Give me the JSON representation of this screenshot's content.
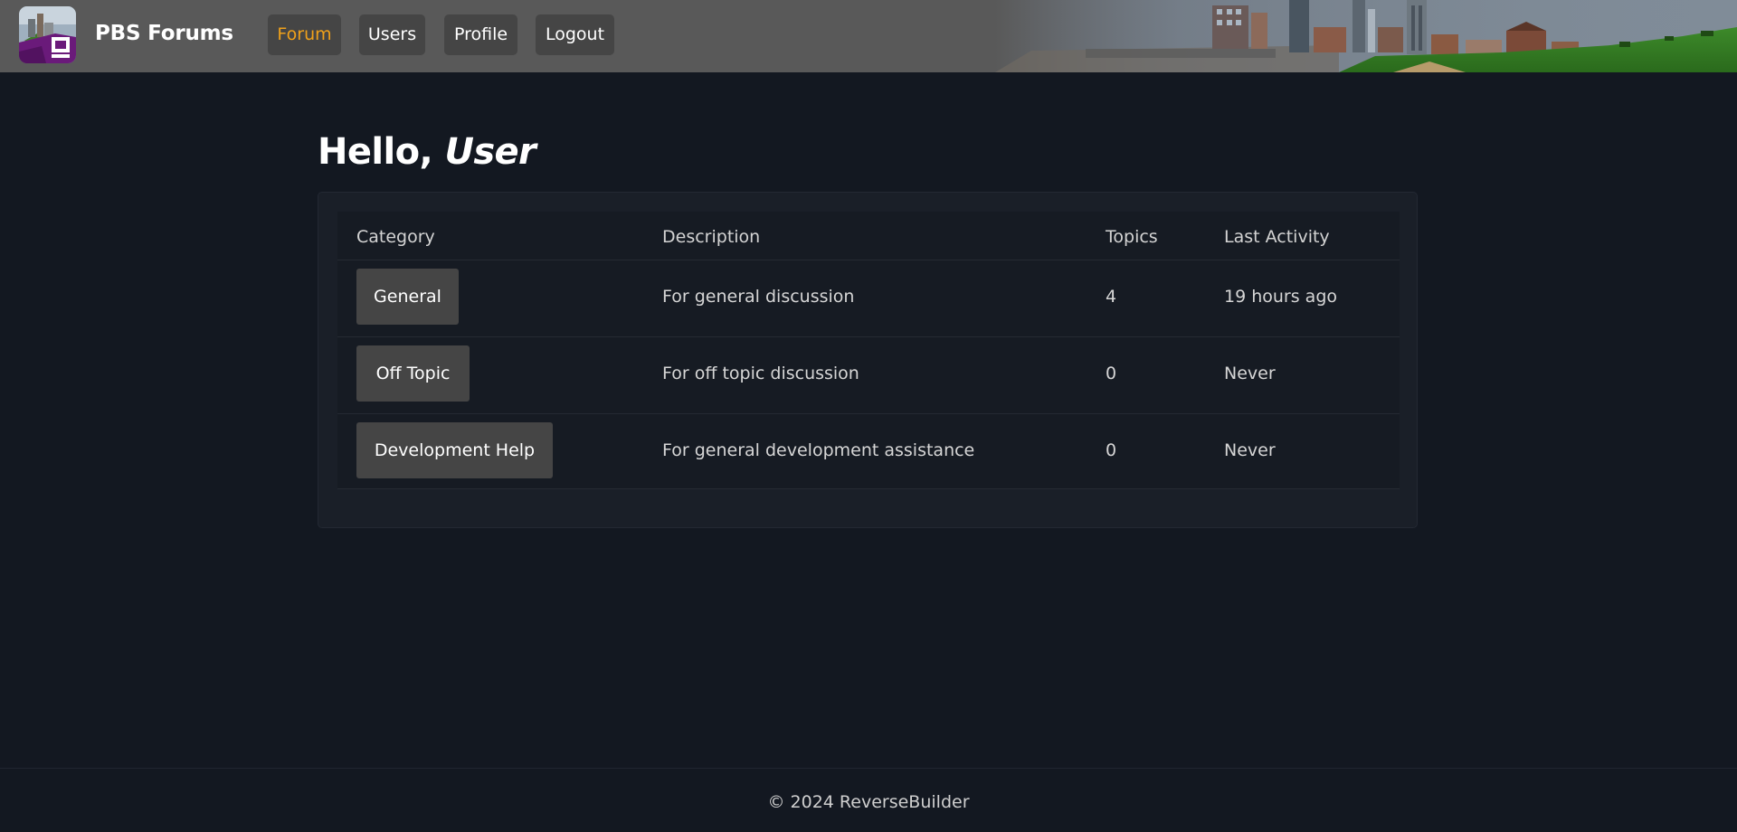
{
  "header": {
    "brand": "PBS Forums",
    "logo_icon": "pbs-logo-icon",
    "nav": [
      {
        "label": "Forum",
        "active": true
      },
      {
        "label": "Users",
        "active": false
      },
      {
        "label": "Profile",
        "active": false
      },
      {
        "label": "Logout",
        "active": false
      }
    ],
    "colors": {
      "bar": "#595959",
      "button": "#454545",
      "active_text": "#f0a11a"
    }
  },
  "main": {
    "greeting_prefix": "Hello,",
    "greeting_name": "User",
    "table": {
      "headers": {
        "category": "Category",
        "description": "Description",
        "topics": "Topics",
        "last_activity": "Last Activity"
      },
      "rows": [
        {
          "category": "General",
          "description": "For general discussion",
          "topics": "4",
          "last_activity": "19 hours ago"
        },
        {
          "category": "Off Topic",
          "description": "For off topic discussion",
          "topics": "0",
          "last_activity": "Never"
        },
        {
          "category": "Development Help",
          "description": "For general development assistance",
          "topics": "0",
          "last_activity": "Never"
        }
      ]
    }
  },
  "footer": {
    "text": "© 2024 ReverseBuilder"
  },
  "colors": {
    "background": "#131821",
    "card": "#1a1f28",
    "table": "#161b23"
  }
}
